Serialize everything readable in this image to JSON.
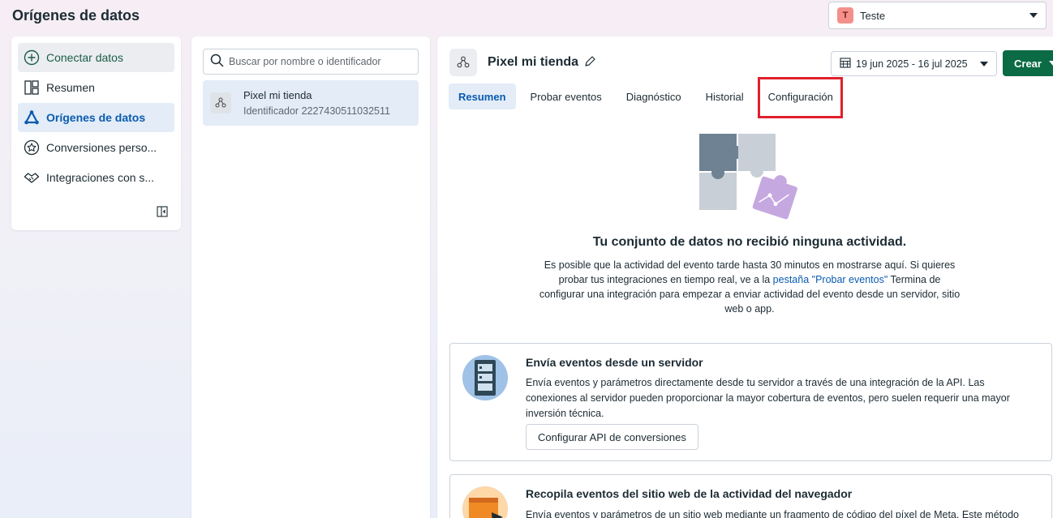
{
  "page": {
    "title": "Orígenes de datos"
  },
  "account": {
    "avatar_letter": "T",
    "name": "Teste"
  },
  "sidebar": {
    "items": [
      {
        "label": "Conectar datos"
      },
      {
        "label": "Resumen"
      },
      {
        "label": "Orígenes de datos"
      },
      {
        "label": "Conversiones perso..."
      },
      {
        "label": "Integraciones con s..."
      }
    ]
  },
  "list": {
    "search_placeholder": "Buscar por nombre o identificador",
    "items": [
      {
        "name": "Pixel mi tienda",
        "id": "Identificador 2227430511032511"
      }
    ]
  },
  "detail": {
    "title": "Pixel mi tienda",
    "date_range": "19 jun 2025 - 16 jul 2025",
    "create_label": "Crear",
    "tabs": [
      {
        "label": "Resumen"
      },
      {
        "label": "Probar eventos"
      },
      {
        "label": "Diagnóstico"
      },
      {
        "label": "Historial"
      },
      {
        "label": "Configuración"
      }
    ],
    "empty": {
      "title": "Tu conjunto de datos no recibió ninguna actividad.",
      "desc_before": "Es posible que la actividad del evento tarde hasta 30 minutos en mostrarse aquí. Si quieres probar tus integraciones en tiempo real, ve a la ",
      "desc_link": "pestaña \"Probar eventos\"",
      "desc_after": " Termina de configurar una integración para empezar a enviar actividad del evento desde un servidor, sitio web o app."
    },
    "cards": [
      {
        "title": "Envía eventos desde un servidor",
        "desc": "Envía eventos y parámetros directamente desde tu servidor a través de una integración de la API. Las conexiones al servidor pueden proporcionar la mayor cobertura de eventos, pero suelen requerir una mayor inversión técnica.",
        "button": "Configurar API de conversiones"
      },
      {
        "title": "Recopila eventos del sitio web de la actividad del navegador",
        "desc": "Envía eventos y parámetros de un sitio web mediante un fragmento de código del píxel de Meta. Este método"
      }
    ]
  }
}
